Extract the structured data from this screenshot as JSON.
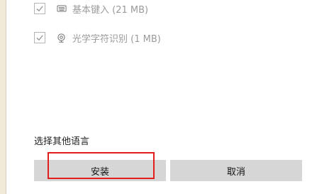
{
  "options": [
    {
      "icon": "keyboard-icon",
      "label": "基本键入 (21 MB)",
      "checked": true
    },
    {
      "icon": "camera-icon",
      "label": "光学字符识别 (1 MB)",
      "checked": true
    }
  ],
  "links": {
    "other_languages": "选择其他语言"
  },
  "buttons": {
    "install": "安装",
    "cancel": "取消"
  },
  "colors": {
    "highlight": "#e11d1d",
    "button_bg": "#d6d6d6",
    "muted_text": "#9b9b9b"
  }
}
